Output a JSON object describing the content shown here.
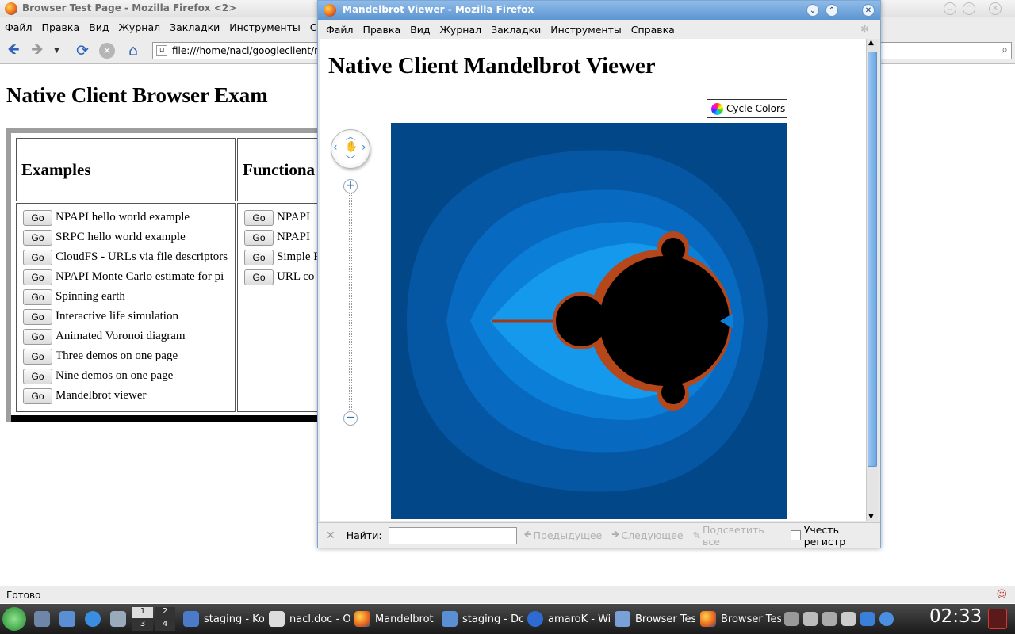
{
  "back_window": {
    "title": "Browser Test Page - Mozilla Firefox <2>",
    "menu": [
      "Файл",
      "Правка",
      "Вид",
      "Журнал",
      "Закладки",
      "Инструменты",
      "Справк"
    ],
    "url": "file:///home/nacl/googleclient/na",
    "page_title": "Native Client Browser Exam",
    "table": {
      "col1_header": "Examples",
      "col2_header": "Functiona",
      "go_label": "Go",
      "examples": [
        "NPAPI hello world example",
        "SRPC hello world example",
        "CloudFS - URLs via file descriptors",
        "NPAPI Monte Carlo estimate for pi",
        "Spinning earth",
        "Interactive life simulation",
        "Animated Voronoi diagram",
        "Three demos on one page",
        "Nine demos on one page",
        "Mandelbrot viewer"
      ],
      "functional": [
        "NPAPI",
        "NPAPI",
        "Simple R",
        "URL co"
      ]
    },
    "status": "Готово"
  },
  "front_window": {
    "title": "Mandelbrot Viewer - Mozilla Firefox",
    "menu": [
      "Файл",
      "Правка",
      "Вид",
      "Журнал",
      "Закладки",
      "Инструменты",
      "Справка"
    ],
    "page_title": "Native Client Mandelbrot Viewer",
    "cycle_colors_label": "Cycle Colors",
    "zoom_in": "+",
    "zoom_out": "−",
    "find": {
      "label": "Найти:",
      "value": "",
      "prev": "Предыдущее",
      "next": "Следующее",
      "highlight": "Подсветить все",
      "match_case": "Учесть регистр"
    }
  },
  "taskbar": {
    "items": [
      "staging - Kon",
      "nacl.doc - O",
      "Mandelbrot V",
      "staging - Dol",
      "amaroK - Wi",
      "Browser Tes",
      "Browser Tes"
    ],
    "pager": [
      "1",
      "2",
      "3",
      "4"
    ],
    "clock": "02:33"
  },
  "colors": {
    "mandel_bg": "#024788",
    "titlebar_active": "#5c95d2",
    "link_blue": "#2f63b8"
  }
}
